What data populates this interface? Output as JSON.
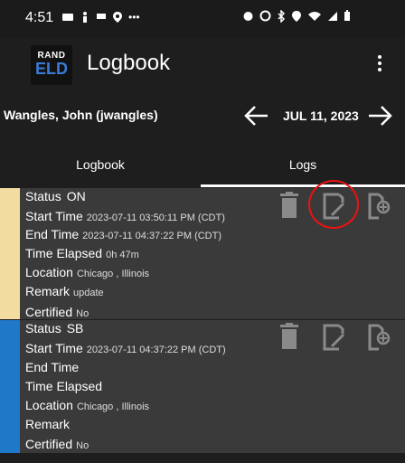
{
  "status_bar": {
    "time": "4:51",
    "left_icons": [
      "notification-icon",
      "accessibility-icon",
      "message-icon",
      "location-icon",
      "more-icon"
    ],
    "right_icons": [
      "alarm-icon",
      "clock-icon",
      "bluetooth-icon",
      "location-icon",
      "wifi-icon",
      "signal-icon",
      "battery-icon"
    ]
  },
  "app_bar": {
    "logo_top": "RAND",
    "logo_bottom": "ELD",
    "title": "Logbook"
  },
  "driver": {
    "name": "Wangles, John (jwangles)",
    "date": "JUL 11, 2023"
  },
  "tabs": [
    {
      "label": "Logbook",
      "selected": false
    },
    {
      "label": "Logs",
      "selected": true
    }
  ],
  "labels": {
    "status": "Status",
    "start_time": "Start Time",
    "end_time": "End Time",
    "time_elapsed": "Time Elapsed",
    "location": "Location",
    "remark": "Remark",
    "certified": "Certified"
  },
  "logs": [
    {
      "status": "ON",
      "status_color": "#f2dca0",
      "start_time": "2023-07-11 03:50:11 PM (CDT)",
      "end_time": "2023-07-11 04:37:22 PM (CDT)",
      "time_elapsed": "0h 47m",
      "location": "Chicago , Illinois",
      "remark": "update",
      "certified": "No"
    },
    {
      "status": "SB",
      "status_color": "#1f78c8",
      "start_time": "2023-07-11 04:37:22 PM (CDT)",
      "end_time": "",
      "time_elapsed": "",
      "location": "Chicago , Illinois",
      "remark": "",
      "certified": "No"
    }
  ],
  "colors": {
    "background": "#1e1e1e",
    "card": "#3a3a3a",
    "icon_gray": "#8a8a8a",
    "highlight": "#e11111"
  }
}
